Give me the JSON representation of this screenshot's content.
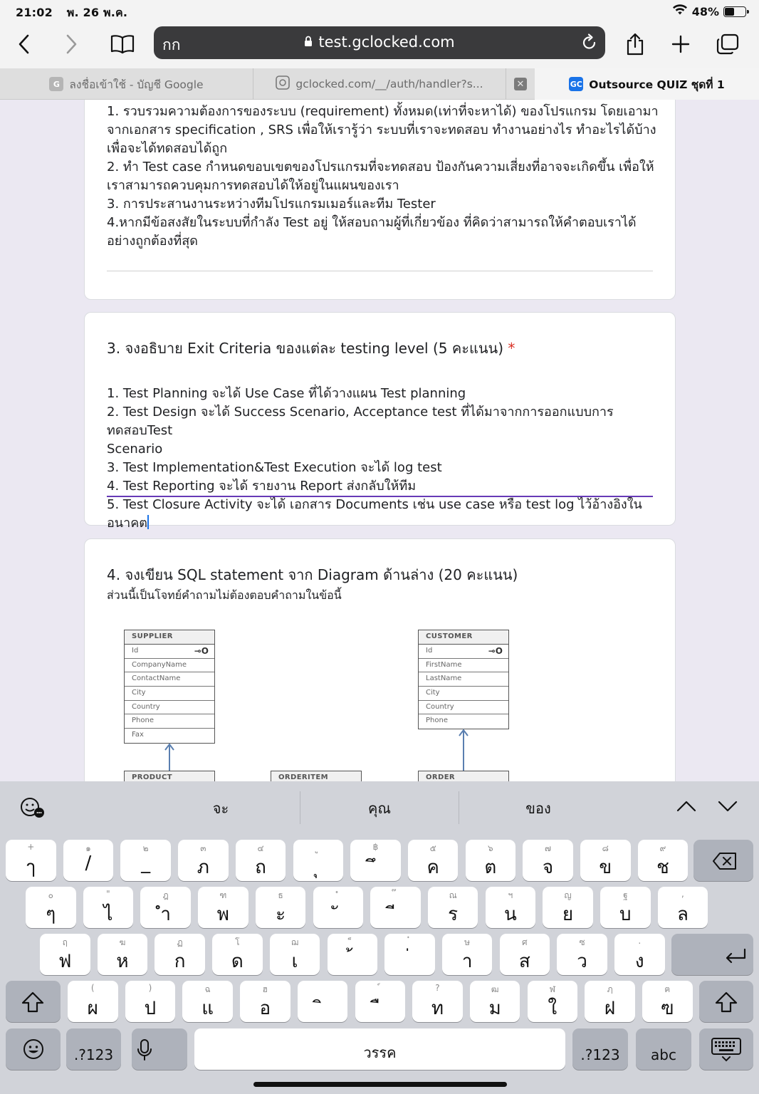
{
  "status": {
    "time": "21:02",
    "date": "พ. 26 พ.ค.",
    "battery": "48%",
    "battery_level": 0.48
  },
  "toolbar": {
    "aa": "กก",
    "url": "test.gclocked.com"
  },
  "tabs": [
    {
      "label": "ลงชื่อเข้าใช้ - บัญชี Google",
      "favicon": "G"
    },
    {
      "label": "gclocked.com/__/auth/handler?s...",
      "favicon": ""
    },
    {
      "label": "Outsource QUIZ ชุดที่ 1",
      "favicon": "GC"
    }
  ],
  "q2": {
    "answer": [
      "1. รวบรวมความต้องการของระบบ (requirement) ทั้งหมด(เท่าที่จะหาได้) ของโปรแกรม โดยเอามา",
      "จากเอกสาร specification , SRS เพื่อให้เรารู้ว่า ระบบที่เราจะทดสอบ ทำงานอย่างไร ทำอะไรได้บ้าง",
      "เพื่อจะได้ทดสอบได้ถูก",
      "2. ทำ Test case กำหนดขอบเขตของโปรแกรมที่จะทดสอบ ป้องกันความเสี่ยงที่อาจจะเกิดขึ้น เพื่อให้",
      "เราสามารถควบคุมการทดสอบได้ให้อยู่ในแผนของเรา",
      "3. การประสานงานระหว่างทีมโปรแกรมเมอร์และทีม Tester",
      "4.หากมีข้อสงสัยในระบบที่กำลัง Test อยู่ ให้สอบถามผู้ที่เกี่ยวข้อง ที่คิดว่าสามารถให้คำตอบเราได้",
      "อย่างถูกต้องที่สุด"
    ]
  },
  "q3": {
    "title": "3. จงอธิบาย Exit Criteria ของแต่ละ testing level (5 คะแนน)",
    "required": "*",
    "answer": [
      "1. Test Planning จะได้ Use Case ที่ได้วางแผน Test planning",
      "2. Test Design จะได้ Success Scenario, Acceptance test ที่ได้มาจากการออกแบบการทดสอบTest",
      "Scenario",
      "3. Test Implementation&Test Execution จะได้ log test",
      "4. Test Reporting จะได้ รายงาน Report ส่งกลับให้ทีม",
      "5. Test Closure Activity จะได้ เอกสาร Documents เช่น use case หรือ test log ไว้อ้างอิงในอนาคต"
    ]
  },
  "q4": {
    "title": "4. จงเขียน SQL statement จาก Diagram ด้านล่าง (20 คะแนน)",
    "description": "ส่วนนี้เป็นโจทย์คำถามไม่ต้องตอบคำถามในข้อนี้",
    "supplier": {
      "name": "SUPPLIER",
      "fields": [
        "Id",
        "CompanyName",
        "ContactName",
        "City",
        "Country",
        "Phone",
        "Fax"
      ]
    },
    "customer": {
      "name": "CUSTOMER",
      "fields": [
        "Id",
        "FirstName",
        "LastName",
        "City",
        "Country",
        "Phone"
      ]
    },
    "product": "PRODUCT",
    "orderitem": "ORDERITEM",
    "order": "ORDER"
  },
  "keyboard": {
    "suggestions": [
      "จะ",
      "คุณ",
      "ของ"
    ],
    "row1": [
      [
        "+",
        "ๅ"
      ],
      [
        "๑",
        "/"
      ],
      [
        "๒",
        "_"
      ],
      [
        "๓",
        "ภ"
      ],
      [
        "๔",
        "ถ"
      ],
      [
        "ู",
        "ุ"
      ],
      [
        "฿",
        "ึ"
      ],
      [
        "๕",
        "ค"
      ],
      [
        "๖",
        "ต"
      ],
      [
        "๗",
        "จ"
      ],
      [
        "๘",
        "ข"
      ],
      [
        "๙",
        "ช"
      ]
    ],
    "row2": [
      [
        "๐",
        "ๆ"
      ],
      [
        "\"",
        "ไ"
      ],
      [
        "ฎ",
        "ำ"
      ],
      [
        "ฑ",
        "พ"
      ],
      [
        "ธ",
        "ะ"
      ],
      [
        "ํ",
        "ั"
      ],
      [
        "๊",
        "ี"
      ],
      [
        "ณ",
        "ร"
      ],
      [
        "ฯ",
        "น"
      ],
      [
        "ญ",
        "ย"
      ],
      [
        "ฐ",
        "บ"
      ],
      [
        ",",
        "ล"
      ]
    ],
    "row3": [
      [
        "ฤ",
        "ฟ"
      ],
      [
        "ฆ",
        "ห"
      ],
      [
        "ฏ",
        "ก"
      ],
      [
        "โ",
        "ด"
      ],
      [
        "ฌ",
        "เ"
      ],
      [
        "็",
        "้"
      ],
      [
        "๋",
        "่"
      ],
      [
        "ษ",
        "า"
      ],
      [
        "ศ",
        "ส"
      ],
      [
        "ซ",
        "ว"
      ],
      [
        ".",
        "ง"
      ]
    ],
    "row4": [
      [
        "(",
        "ผ"
      ],
      [
        ")",
        "ป"
      ],
      [
        "ฉ",
        "แ"
      ],
      [
        "ฮ",
        "อ"
      ],
      [
        "",
        "ิ"
      ],
      [
        "์",
        "ื"
      ],
      [
        "?",
        "ท"
      ],
      [
        "ฒ",
        "ม"
      ],
      [
        "ฬ",
        "ใ"
      ],
      [
        "ฦ",
        "ฝ"
      ],
      [
        "ฅ",
        "ฃ"
      ]
    ],
    "numbers_label": ".?123",
    "space_label": "วรรค",
    "abc_label": "abc"
  }
}
